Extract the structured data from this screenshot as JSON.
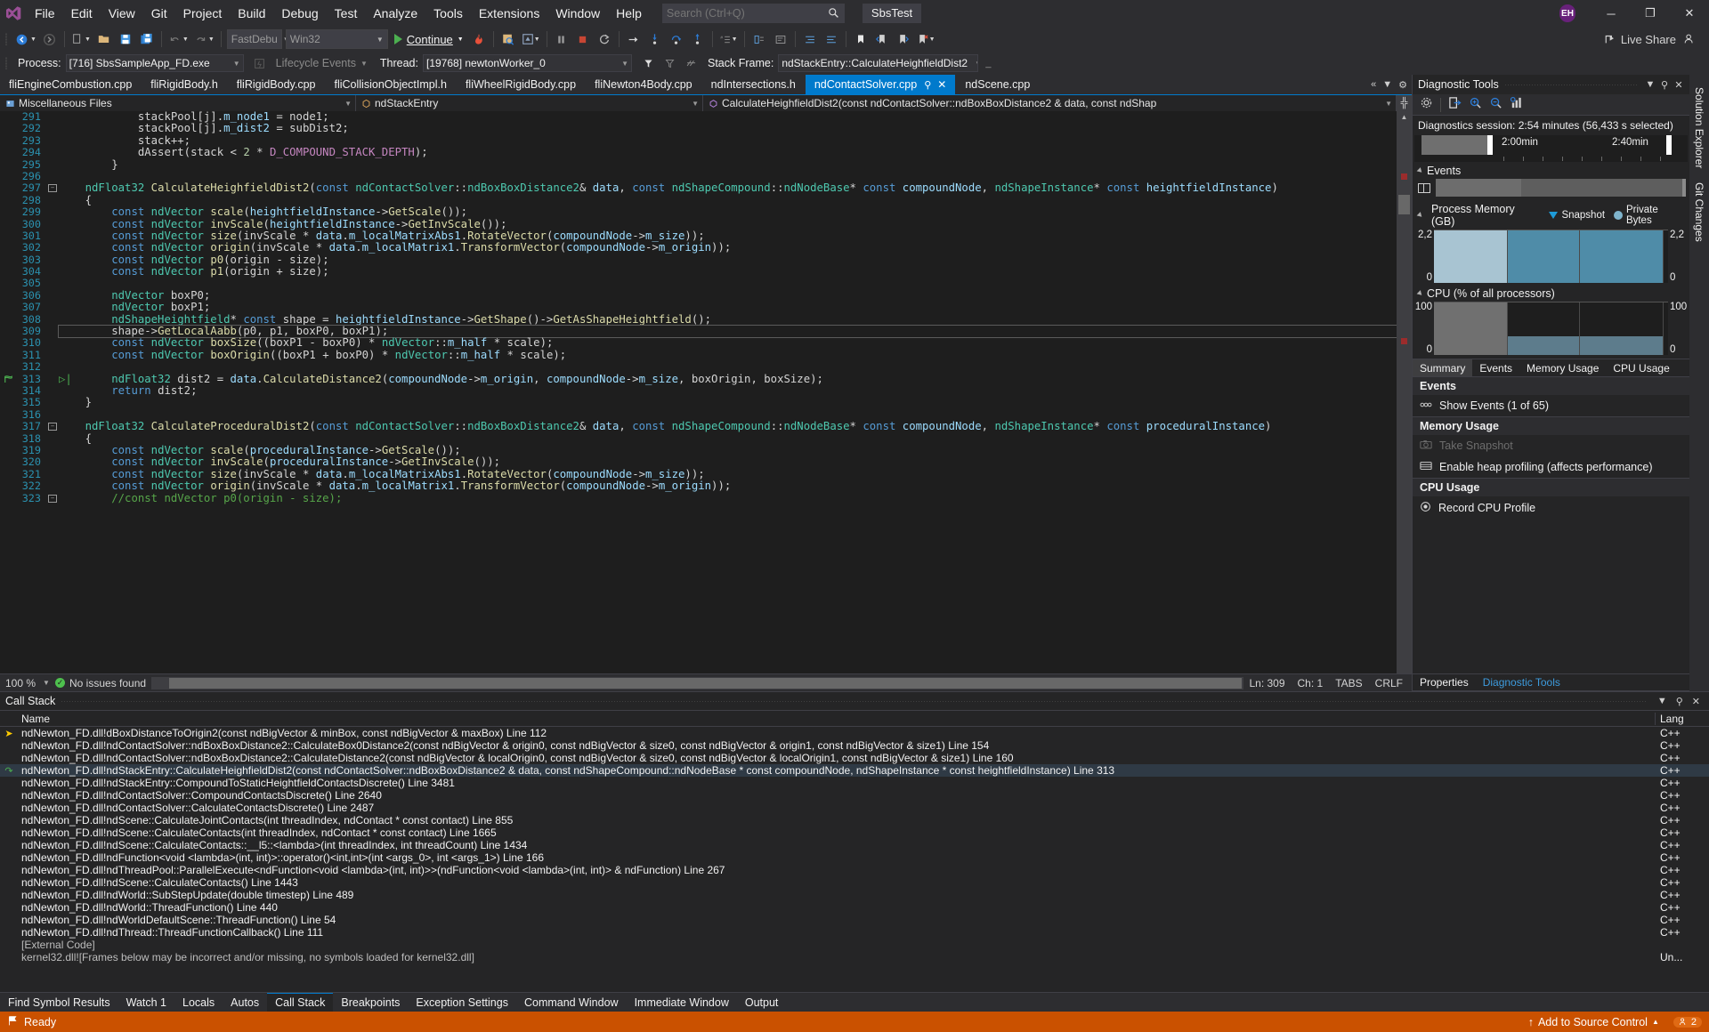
{
  "window": {
    "solution_name": "SbsTest",
    "user_initials": "EH",
    "minimize": "─",
    "restore": "❐",
    "close": "✕"
  },
  "menu": {
    "items": [
      "File",
      "Edit",
      "View",
      "Git",
      "Project",
      "Build",
      "Debug",
      "Test",
      "Analyze",
      "Tools",
      "Extensions",
      "Window",
      "Help"
    ]
  },
  "search": {
    "placeholder": "Search (Ctrl+Q)",
    "icon": "search-icon"
  },
  "toolbar": {
    "config_combo": "FastDebu",
    "platform_combo": "Win32",
    "continue_label": "Continue",
    "live_share": "Live Share"
  },
  "debugbar": {
    "process_label": "Process:",
    "process_value": "[716] SbsSampleApp_FD.exe",
    "lifecycle_label": "Lifecycle Events",
    "thread_label": "Thread:",
    "thread_value": "[19768] newtonWorker_0",
    "stackframe_label": "Stack Frame:",
    "stackframe_value": "ndStackEntry::CalculateHeighfieldDist2"
  },
  "tabs": [
    {
      "label": "fliEngineCombustion.cpp",
      "active": false
    },
    {
      "label": "fliRigidBody.h",
      "active": false
    },
    {
      "label": "fliRigidBody.cpp",
      "active": false
    },
    {
      "label": "fliCollisionObjectImpl.h",
      "active": false
    },
    {
      "label": "fliWheelRigidBody.cpp",
      "active": false
    },
    {
      "label": "fliNewton4Body.cpp",
      "active": false
    },
    {
      "label": "ndIntersections.h",
      "active": false
    },
    {
      "label": "ndContactSolver.cpp",
      "active": true
    },
    {
      "label": "ndScene.cpp",
      "active": false
    }
  ],
  "navbar": {
    "project": "Miscellaneous Files",
    "type": "ndStackEntry",
    "member": "CalculateHeighfieldDist2(const ndContactSolver::ndBoxBoxDistance2 & data, const ndShap"
  },
  "editor": {
    "zoom": "100 %",
    "issues": "No issues found",
    "line_col": "Ln: 309",
    "ch": "Ch: 1",
    "tabs_mode": "TABS",
    "eol": "CRLF",
    "first_line": 291,
    "lines": [
      {
        "n": 291,
        "html": "            <span class='ident'>stackPool</span>[<span class='ident'>j</span>].<span class='var'>m_node1</span> = <span class='ident'>node1</span>;"
      },
      {
        "n": 292,
        "html": "            <span class='ident'>stackPool</span>[<span class='ident'>j</span>].<span class='var'>m_dist2</span> = <span class='ident'>subDist2</span>;"
      },
      {
        "n": 293,
        "html": "            <span class='ident'>stack</span>++;"
      },
      {
        "n": 294,
        "html": "            <span class='ident'>dAssert</span>(<span class='ident'>stack</span> &lt; <span class='num'>2</span> * <span class='mac'>D_COMPOUND_STACK_DEPTH</span>);"
      },
      {
        "n": 295,
        "html": "        }"
      },
      {
        "n": 296,
        "html": ""
      },
      {
        "n": 297,
        "fold": "minus",
        "html": "    <span class='typ'>ndFloat32</span> <span class='fn'>CalculateHeighfieldDist2</span>(<span class='kw'>const</span> <span class='typ'>ndContactSolver</span>::<span class='typ'>ndBoxBoxDistance2</span>&amp; <span class='var'>data</span>, <span class='kw'>const</span> <span class='typ'>ndShapeCompound</span>::<span class='typ'>ndNodeBase</span>* <span class='kw'>const</span> <span class='var'>compoundNode</span>, <span class='typ'>ndShapeInstance</span>* <span class='kw'>const</span> <span class='var'>heightfieldInstance</span>)"
      },
      {
        "n": 298,
        "html": "    {"
      },
      {
        "n": 299,
        "html": "        <span class='kw'>const</span> <span class='typ'>ndVector</span> <span class='fn'>scale</span>(<span class='var'>heightfieldInstance</span>-&gt;<span class='fn'>GetScale</span>());"
      },
      {
        "n": 300,
        "html": "        <span class='kw'>const</span> <span class='typ'>ndVector</span> <span class='fn'>invScale</span>(<span class='var'>heightfieldInstance</span>-&gt;<span class='fn'>GetInvScale</span>());"
      },
      {
        "n": 301,
        "html": "        <span class='kw'>const</span> <span class='typ'>ndVector</span> <span class='fn'>size</span>(<span class='ident'>invScale</span> * <span class='var'>data</span>.<span class='var'>m_localMatrixAbs1</span>.<span class='fn'>RotateVector</span>(<span class='var'>compoundNode</span>-&gt;<span class='var'>m_size</span>));"
      },
      {
        "n": 302,
        "html": "        <span class='kw'>const</span> <span class='typ'>ndVector</span> <span class='fn'>origin</span>(<span class='ident'>invScale</span> * <span class='var'>data</span>.<span class='var'>m_localMatrix1</span>.<span class='fn'>TransformVector</span>(<span class='var'>compoundNode</span>-&gt;<span class='var'>m_origin</span>));"
      },
      {
        "n": 303,
        "html": "        <span class='kw'>const</span> <span class='typ'>ndVector</span> <span class='fn'>p0</span>(<span class='ident'>origin</span> - <span class='ident'>size</span>);"
      },
      {
        "n": 304,
        "html": "        <span class='kw'>const</span> <span class='typ'>ndVector</span> <span class='fn'>p1</span>(<span class='ident'>origin</span> + <span class='ident'>size</span>);"
      },
      {
        "n": 305,
        "html": ""
      },
      {
        "n": 306,
        "html": "        <span class='typ'>ndVector</span> <span class='ident'>boxP0</span>;"
      },
      {
        "n": 307,
        "html": "        <span class='typ'>ndVector</span> <span class='ident'>boxP1</span>;"
      },
      {
        "n": 308,
        "html": "        <span class='typ'>ndShapeHeightfield</span>* <span class='kw'>const</span> <span class='ident'>shape</span> = <span class='var'>heightfieldInstance</span>-&gt;<span class='fn'>GetShape</span>()-&gt;<span class='fn'>GetAsShapeHeightfield</span>();"
      },
      {
        "n": 309,
        "highlight": true,
        "html": "        <span class='ident'>shape</span>-&gt;<span class='fn'>GetLocalAabb</span>(<span class='ident'>p0</span>, <span class='ident'>p1</span>, <span class='ident'>boxP0</span>, <span class='ident'>boxP1</span>);"
      },
      {
        "n": 310,
        "html": "        <span class='kw'>const</span> <span class='typ'>ndVector</span> <span class='fn'>boxSize</span>((<span class='ident'>boxP1</span> - <span class='ident'>boxP0</span>) * <span class='typ'>ndVector</span>::<span class='var'>m_half</span> * <span class='ident'>scale</span>);"
      },
      {
        "n": 311,
        "html": "        <span class='kw'>const</span> <span class='typ'>ndVector</span> <span class='fn'>boxOrigin</span>((<span class='ident'>boxP1</span> + <span class='ident'>boxP0</span>) * <span class='typ'>ndVector</span>::<span class='var'>m_half</span> * <span class='ident'>scale</span>);"
      },
      {
        "n": 312,
        "html": ""
      },
      {
        "n": 313,
        "current": true,
        "html": "        <span class='typ'>ndFloat32</span> <span class='ident'>dist2</span> = <span class='var'>data</span>.<span class='fn'>CalculateDistance2</span>(<span class='var'>compoundNode</span>-&gt;<span class='var'>m_origin</span>, <span class='var'>compoundNode</span>-&gt;<span class='var'>m_size</span>, <span class='ident'>boxOrigin</span>, <span class='ident'>boxSize</span>);"
      },
      {
        "n": 314,
        "html": "        <span class='kw'>return</span> <span class='ident'>dist2</span>;"
      },
      {
        "n": 315,
        "html": "    }"
      },
      {
        "n": 316,
        "html": ""
      },
      {
        "n": 317,
        "fold": "minus",
        "html": "    <span class='typ'>ndFloat32</span> <span class='fn'>CalculateProceduralDist2</span>(<span class='kw'>const</span> <span class='typ'>ndContactSolver</span>::<span class='typ'>ndBoxBoxDistance2</span>&amp; <span class='var'>data</span>, <span class='kw'>const</span> <span class='typ'>ndShapeCompound</span>::<span class='typ'>ndNodeBase</span>* <span class='kw'>const</span> <span class='var'>compoundNode</span>, <span class='typ'>ndShapeInstance</span>* <span class='kw'>const</span> <span class='var'>proceduralInstance</span>)"
      },
      {
        "n": 318,
        "html": "    {"
      },
      {
        "n": 319,
        "html": "        <span class='kw'>const</span> <span class='typ'>ndVector</span> <span class='fn'>scale</span>(<span class='var'>proceduralInstance</span>-&gt;<span class='fn'>GetScale</span>());"
      },
      {
        "n": 320,
        "html": "        <span class='kw'>const</span> <span class='typ'>ndVector</span> <span class='fn'>invScale</span>(<span class='var'>proceduralInstance</span>-&gt;<span class='fn'>GetInvScale</span>());"
      },
      {
        "n": 321,
        "html": "        <span class='kw'>const</span> <span class='typ'>ndVector</span> <span class='fn'>size</span>(<span class='ident'>invScale</span> * <span class='var'>data</span>.<span class='var'>m_localMatrixAbs1</span>.<span class='fn'>RotateVector</span>(<span class='var'>compoundNode</span>-&gt;<span class='var'>m_size</span>));"
      },
      {
        "n": 322,
        "html": "        <span class='kw'>const</span> <span class='typ'>ndVector</span> <span class='fn'>origin</span>(<span class='ident'>invScale</span> * <span class='var'>data</span>.<span class='var'>m_localMatrix1</span>.<span class='fn'>TransformVector</span>(<span class='var'>compoundNode</span>-&gt;<span class='var'>m_origin</span>));"
      },
      {
        "n": 323,
        "fold": "minus",
        "html": "        <span class='cmt'>//const ndVector p0(origin - size);</span>"
      }
    ]
  },
  "diagnostics": {
    "title": "Diagnostic Tools",
    "session_text": "Diagnostics session: 2:54 minutes (56,433 s selected)",
    "timeline": {
      "label_1": "2:00min",
      "label_2": "2:40min"
    },
    "events_header": "Events",
    "memory_header": "Process Memory (GB)",
    "memory_legend_snapshot": "Snapshot",
    "memory_legend_private": "Private Bytes",
    "memory_max": "2,2",
    "memory_min": "0",
    "cpu_header": "CPU (% of all processors)",
    "cpu_max": "100",
    "cpu_min": "0",
    "tabs": [
      "Summary",
      "Events",
      "Memory Usage",
      "CPU Usage"
    ],
    "active_tab": "Summary",
    "sections": [
      {
        "title": "Events",
        "items": [
          {
            "label": "Show Events (1 of 65)",
            "icon": "events-icon",
            "disabled": false
          }
        ]
      },
      {
        "title": "Memory Usage",
        "items": [
          {
            "label": "Take Snapshot",
            "icon": "camera-icon",
            "disabled": true
          },
          {
            "label": "Enable heap profiling (affects performance)",
            "icon": "heap-icon",
            "disabled": false
          }
        ]
      },
      {
        "title": "CPU Usage",
        "items": [
          {
            "label": "Record CPU Profile",
            "icon": "record-icon",
            "disabled": false
          }
        ]
      }
    ]
  },
  "right_rail": {
    "tabs": [
      "Solution Explorer",
      "Git Changes"
    ]
  },
  "bottom_panel": {
    "title": "Call Stack",
    "columns": {
      "name": "Name",
      "lang": "Lang"
    },
    "rows": [
      {
        "marker": "yellow",
        "name": "ndNewton_FD.dll!dBoxDistanceToOrigin2(const ndBigVector & minBox, const ndBigVector & maxBox) Line 112",
        "lang": "C++"
      },
      {
        "marker": "",
        "name": "ndNewton_FD.dll!ndContactSolver::ndBoxBoxDistance2::CalculateBox0Distance2(const ndBigVector & origin0, const ndBigVector & size0, const ndBigVector & origin1, const ndBigVector & size1) Line 154",
        "lang": "C++"
      },
      {
        "marker": "",
        "name": "ndNewton_FD.dll!ndContactSolver::ndBoxBoxDistance2::CalculateDistance2(const ndBigVector & localOrigin0, const ndBigVector & size0, const ndBigVector & localOrigin1, const ndBigVector & size1) Line 160",
        "lang": "C++"
      },
      {
        "marker": "green",
        "selected": true,
        "name": "ndNewton_FD.dll!ndStackEntry::CalculateHeighfieldDist2(const ndContactSolver::ndBoxBoxDistance2 & data, const ndShapeCompound::ndNodeBase * const compoundNode, ndShapeInstance * const heightfieldInstance) Line 313",
        "lang": "C++"
      },
      {
        "marker": "",
        "name": "ndNewton_FD.dll!ndStackEntry::CompoundToStaticHeightfieldContactsDiscrete() Line 3481",
        "lang": "C++"
      },
      {
        "marker": "",
        "name": "ndNewton_FD.dll!ndContactSolver::CompoundContactsDiscrete() Line 2640",
        "lang": "C++"
      },
      {
        "marker": "",
        "name": "ndNewton_FD.dll!ndContactSolver::CalculateContactsDiscrete() Line 2487",
        "lang": "C++"
      },
      {
        "marker": "",
        "name": "ndNewton_FD.dll!ndScene::CalculateJointContacts(int threadIndex, ndContact * const contact) Line 855",
        "lang": "C++"
      },
      {
        "marker": "",
        "name": "ndNewton_FD.dll!ndScene::CalculateContacts(int threadIndex, ndContact * const contact) Line 1665",
        "lang": "C++"
      },
      {
        "marker": "",
        "name": "ndNewton_FD.dll!ndScene::CalculateContacts::__l5::<lambda>(int threadIndex, int threadCount) Line 1434",
        "lang": "C++"
      },
      {
        "marker": "",
        "name": "ndNewton_FD.dll!ndFunction<void <lambda>(int, int)>::operator()<int,int>(int <args_0>, int <args_1>) Line 166",
        "lang": "C++"
      },
      {
        "marker": "",
        "name": "ndNewton_FD.dll!ndThreadPool::ParallelExecute<ndFunction<void <lambda>(int, int)>>(ndFunction<void <lambda>(int, int)> & ndFunction) Line 267",
        "lang": "C++"
      },
      {
        "marker": "",
        "name": "ndNewton_FD.dll!ndScene::CalculateContacts() Line 1443",
        "lang": "C++"
      },
      {
        "marker": "",
        "name": "ndNewton_FD.dll!ndWorld::SubStepUpdate(double timestep) Line 489",
        "lang": "C++"
      },
      {
        "marker": "",
        "name": "ndNewton_FD.dll!ndWorld::ThreadFunction() Line 440",
        "lang": "C++"
      },
      {
        "marker": "",
        "name": "ndNewton_FD.dll!ndWorldDefaultScene::ThreadFunction() Line 54",
        "lang": "C++"
      },
      {
        "marker": "",
        "name": "ndNewton_FD.dll!ndThread::ThreadFunctionCallback() Line 111",
        "lang": "C++"
      },
      {
        "marker": "",
        "external": true,
        "name": "[External Code]",
        "lang": ""
      },
      {
        "marker": "",
        "external": true,
        "name": "kernel32.dll![Frames below may be incorrect and/or missing, no symbols loaded for kernel32.dll]",
        "lang": "Un..."
      }
    ],
    "tabs": [
      "Find Symbol Results",
      "Watch 1",
      "Locals",
      "Autos",
      "Call Stack",
      "Breakpoints",
      "Exception Settings",
      "Command Window",
      "Immediate Window",
      "Output"
    ],
    "active_tab": "Call Stack"
  },
  "statusbar": {
    "ready": "Ready",
    "source_control": "Add to Source Control",
    "notifications_count": "2"
  },
  "colors": {
    "accent": "#007acc",
    "status_bar": "#ca5100",
    "breakpoint": "#e51400",
    "current_line_arrow": "#4caf50"
  }
}
